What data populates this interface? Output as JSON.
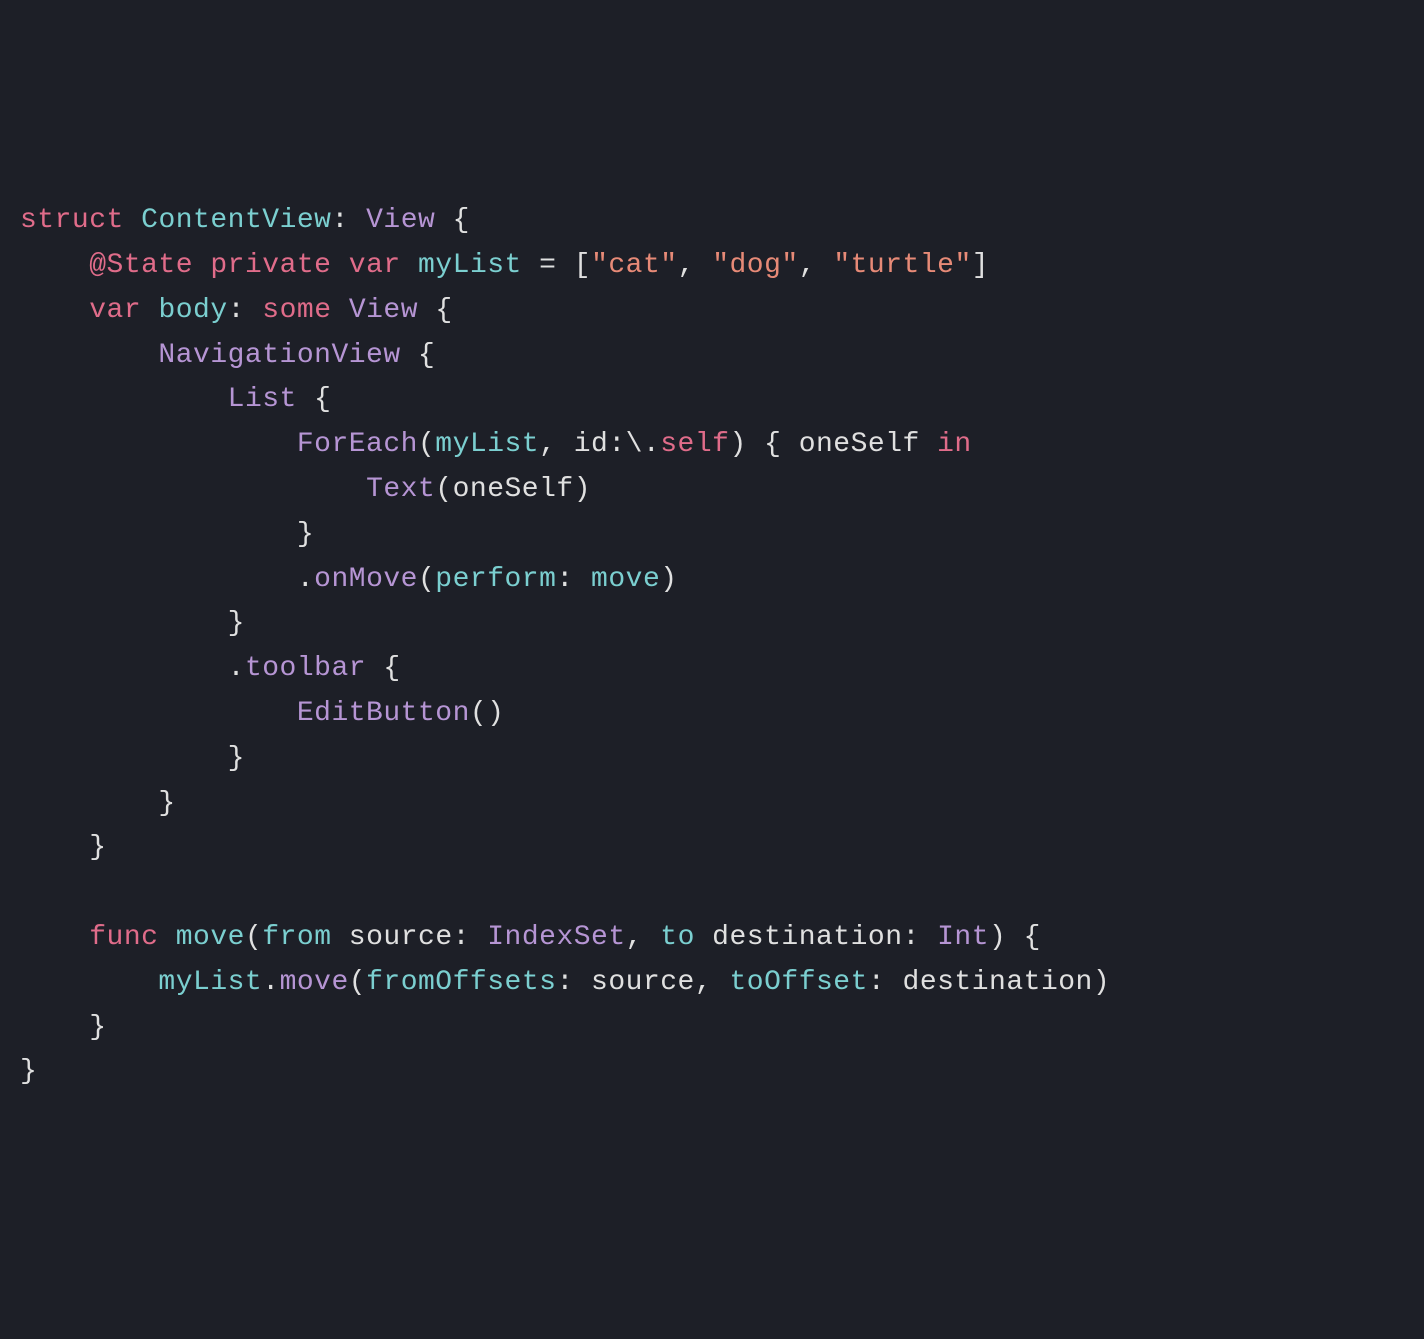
{
  "code": {
    "line1": {
      "struct": "struct",
      "name": "ContentView",
      "colon": ":",
      "view": "View",
      "brace": " {"
    },
    "line2": {
      "indent": "    ",
      "state": "@State",
      "private": "private",
      "var": "var",
      "name": "myList",
      "equals": " = [",
      "str1": "\"cat\"",
      "comma1": ", ",
      "str2": "\"dog\"",
      "comma2": ", ",
      "str3": "\"turtle\"",
      "close": "]"
    },
    "line3": {
      "indent": "    ",
      "var": "var",
      "body": "body",
      "colon": ":",
      "some": "some",
      "view": "View",
      "brace": " {"
    },
    "line4": {
      "indent": "        ",
      "nav": "NavigationView",
      "brace": " {"
    },
    "line5": {
      "indent": "            ",
      "list": "List",
      "brace": " {"
    },
    "line6": {
      "indent": "                ",
      "foreach": "ForEach",
      "open": "(",
      "mylist": "myList",
      "comma": ", ",
      "id": "id",
      "colon": ":\\.",
      "self": "self",
      "close": ") { ",
      "oneself": "oneSelf",
      "in": "in"
    },
    "line7": {
      "indent": "                    ",
      "text": "Text",
      "open": "(",
      "oneself": "oneSelf",
      "close": ")"
    },
    "line8": {
      "indent": "                ",
      "brace": "}"
    },
    "line9": {
      "indent": "                .",
      "onmove": "onMove",
      "open": "(",
      "perform": "perform",
      "colon": ": ",
      "move": "move",
      "close": ")"
    },
    "line10": {
      "indent": "            ",
      "brace": "}"
    },
    "line11": {
      "indent": "            .",
      "toolbar": "toolbar",
      "brace": " {"
    },
    "line12": {
      "indent": "                ",
      "editbutton": "EditButton",
      "parens": "()"
    },
    "line13": {
      "indent": "            ",
      "brace": "}"
    },
    "line14": {
      "indent": "        ",
      "brace": "}"
    },
    "line15": {
      "indent": "    ",
      "brace": "}"
    },
    "line16": {
      "blank": ""
    },
    "line17": {
      "indent": "    ",
      "func": "func",
      "name": "move",
      "open": "(",
      "from": "from",
      "source": " source",
      "colon1": ": ",
      "indexset": "IndexSet",
      "comma": ", ",
      "to": "to",
      "dest": " destination",
      "colon2": ": ",
      "int": "Int",
      "close": ") {"
    },
    "line18": {
      "indent": "        ",
      "mylist": "myList",
      "dot": ".",
      "move": "move",
      "open": "(",
      "fromoffsets": "fromOffsets",
      "colon1": ": ",
      "source": "source",
      "comma": ", ",
      "tooffset": "toOffset",
      "colon2": ": ",
      "dest": "destination",
      "close": ")"
    },
    "line19": {
      "indent": "    ",
      "brace": "}"
    },
    "line20": {
      "brace": "}"
    }
  }
}
